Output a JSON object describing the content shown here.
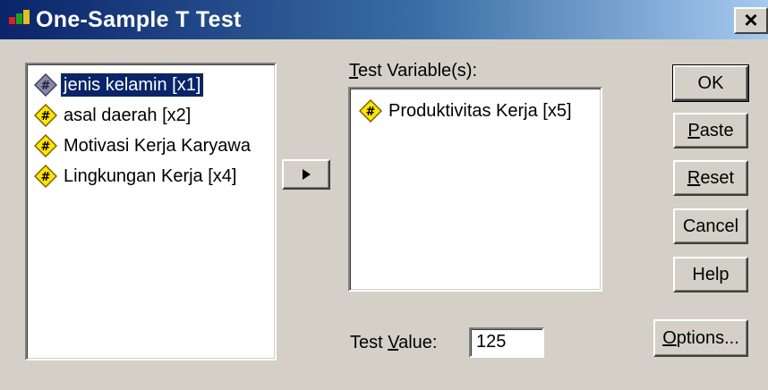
{
  "window": {
    "title": "One-Sample T Test",
    "close_label": "×"
  },
  "source_list": {
    "items": [
      {
        "label": "jenis kelamin [x1]",
        "selected": true
      },
      {
        "label": "asal daerah [x2]",
        "selected": false
      },
      {
        "label": "Motivasi Kerja Karyawa",
        "selected": false
      },
      {
        "label": "Lingkungan Kerja [x4]",
        "selected": false
      }
    ]
  },
  "move_button": {
    "icon": "triangle-right-icon"
  },
  "test_variables": {
    "label_mnemonic": "T",
    "label_rest": "est Variable(s):",
    "items": [
      {
        "label": "Produktivitas Kerja [x5]"
      }
    ]
  },
  "test_value": {
    "label_pre": "Test ",
    "label_mnemonic": "V",
    "label_rest": "alue:",
    "value": "125"
  },
  "buttons": {
    "ok": "OK",
    "paste_mnemonic": "P",
    "paste_rest": "aste",
    "reset_mnemonic": "R",
    "reset_rest": "eset",
    "cancel": "Cancel",
    "help": "Help",
    "options_mnemonic": "O",
    "options_rest": "ptions..."
  },
  "colors": {
    "title_gradient_start": "#0a246a",
    "title_gradient_end": "#a6caf0",
    "selection": "#0a246a",
    "scale_icon_fill": "#ffe600"
  }
}
